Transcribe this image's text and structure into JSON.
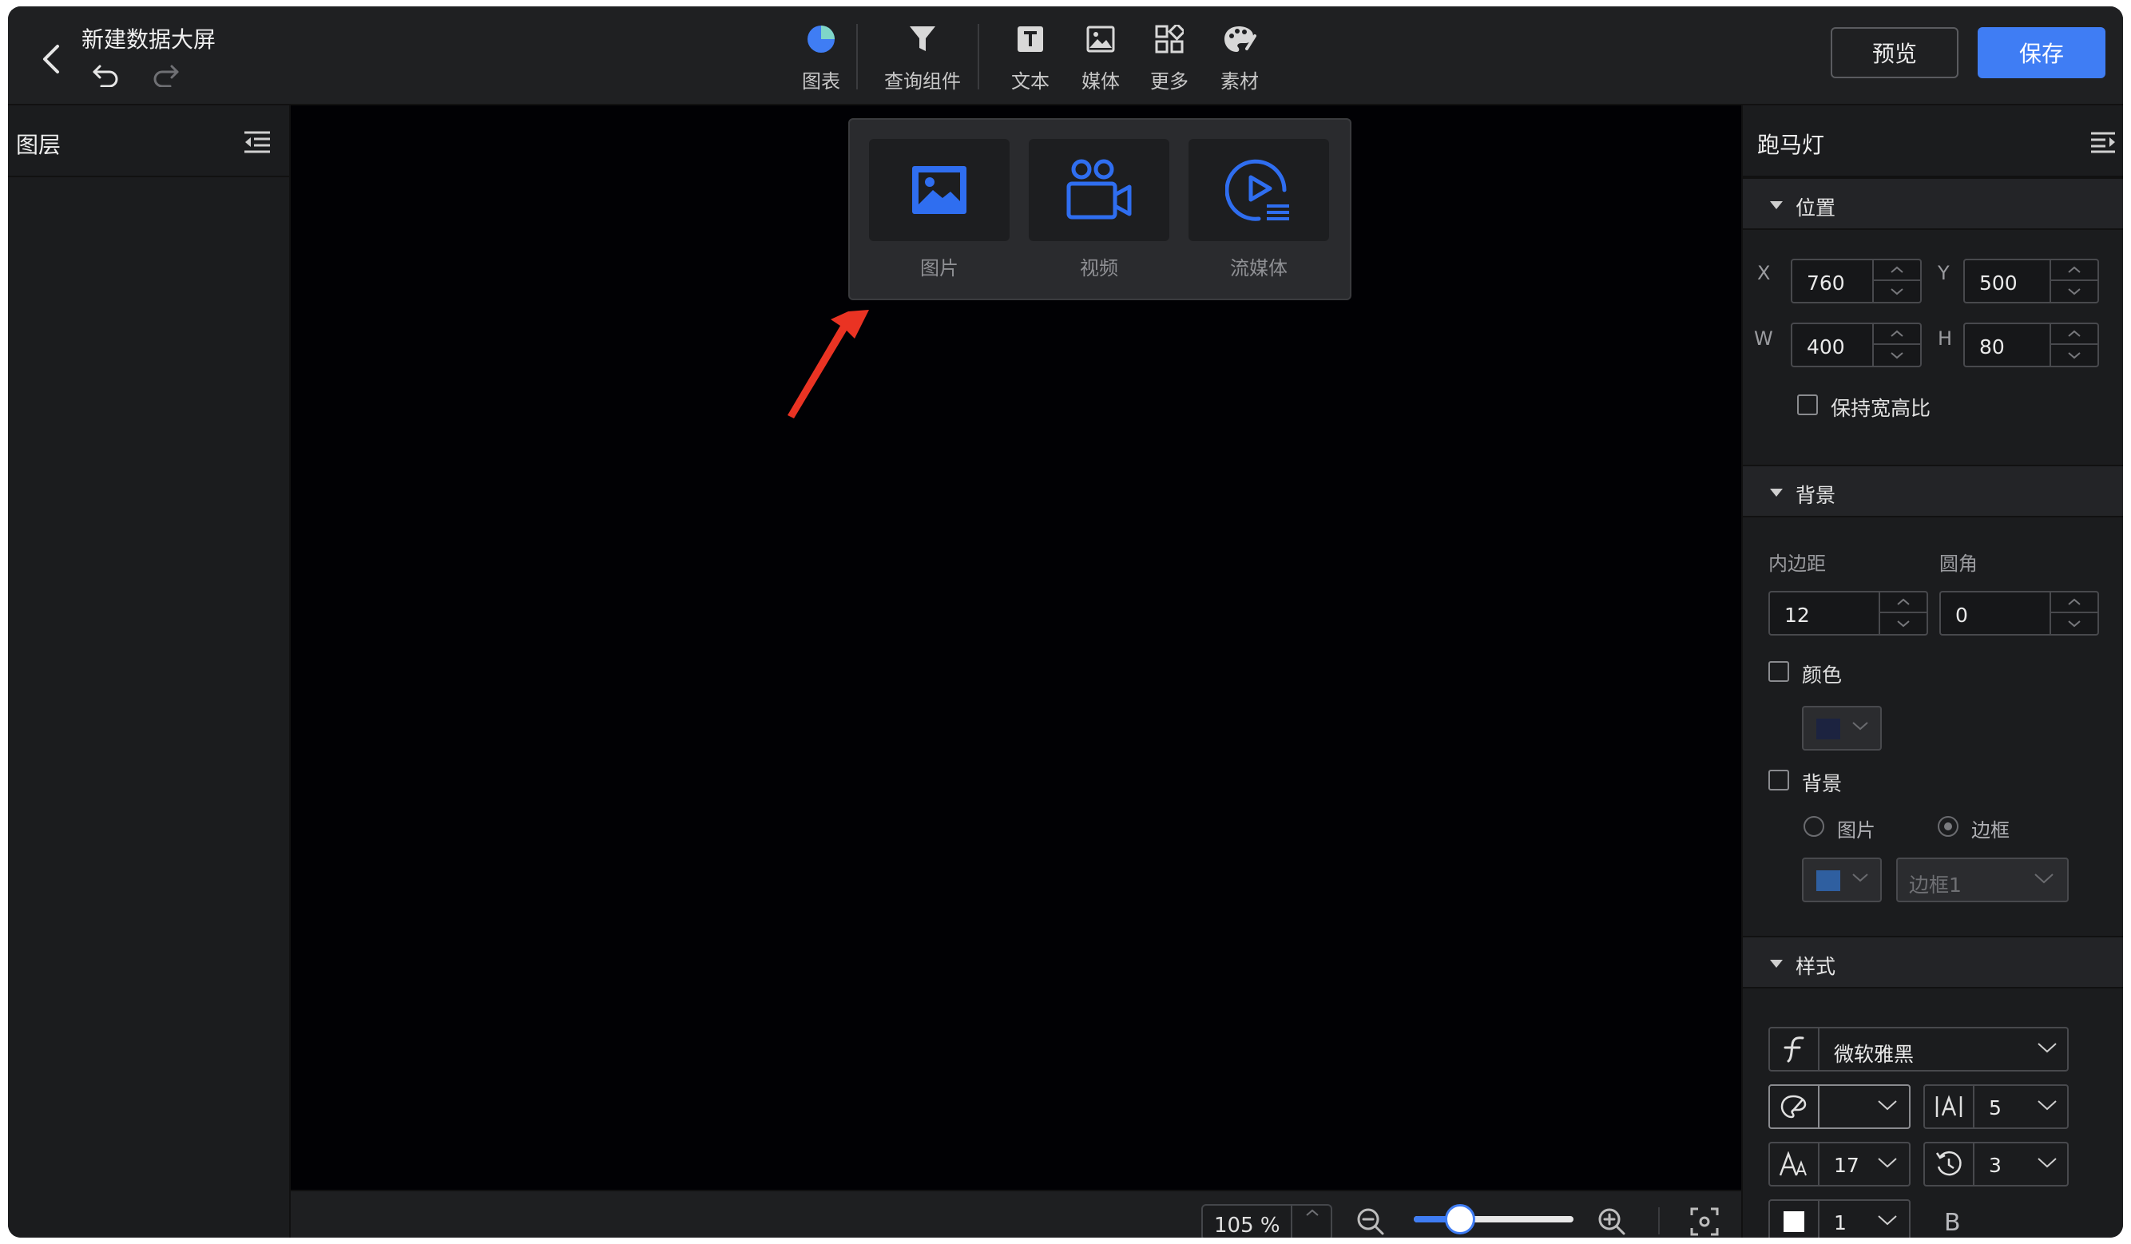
{
  "header": {
    "title": "新建数据大屏",
    "tools": [
      {
        "label": "图表",
        "icon": "pie-chart-icon"
      },
      {
        "label": "查询组件",
        "icon": "filter-icon"
      },
      {
        "label": "文本",
        "icon": "text-icon"
      },
      {
        "label": "媒体",
        "icon": "image-icon"
      },
      {
        "label": "更多",
        "icon": "grid-icon"
      },
      {
        "label": "素材",
        "icon": "palette-icon"
      }
    ],
    "preview_label": "预览",
    "save_label": "保存",
    "accent_color": "#3f7df4"
  },
  "left_panel": {
    "title": "图层"
  },
  "media_menu": {
    "items": [
      {
        "label": "图片",
        "icon": "picture-icon"
      },
      {
        "label": "视频",
        "icon": "video-camera-icon"
      },
      {
        "label": "流媒体",
        "icon": "streaming-icon"
      }
    ]
  },
  "bottom_bar": {
    "zoom_value": "105",
    "zoom_unit": "%",
    "zoom_slider_fraction": 0.29
  },
  "right_panel": {
    "title": "跑马灯",
    "position": {
      "title": "位置",
      "x_label": "X",
      "x_value": "760",
      "y_label": "Y",
      "y_value": "500",
      "w_label": "W",
      "w_value": "400",
      "h_label": "H",
      "h_value": "80",
      "keep_ratio_label": "保持宽高比"
    },
    "background": {
      "title": "背景",
      "padding_label": "内边距",
      "padding_value": "12",
      "radius_label": "圆角",
      "radius_value": "0",
      "color_label": "颜色",
      "bg_label": "背景",
      "image_option": "图片",
      "border_option": "边框",
      "border_select": "边框1",
      "color_swatch": "#1c2340",
      "bg_swatch": "#2f5fa0"
    },
    "style": {
      "title": "样式",
      "font_value": "微软雅黑",
      "letter_spacing": "5",
      "font_size": "17",
      "speed": "3",
      "line_value": "1",
      "bold_label": "B"
    }
  }
}
